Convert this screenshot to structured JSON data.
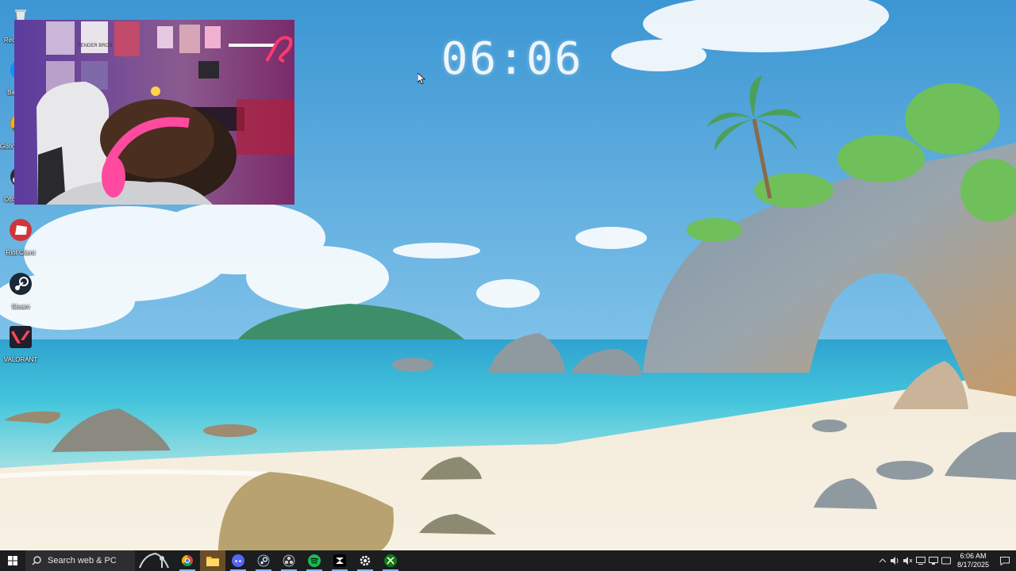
{
  "clock": {
    "time": "06:06"
  },
  "desktop_icons": [
    {
      "label": "Recycle Bin",
      "icon": "recycle-bin-icon"
    },
    {
      "label": "Battle.net",
      "icon": "battlenet-icon"
    },
    {
      "label": "Google Chrome",
      "icon": "chrome-icon"
    },
    {
      "label": "OBS Studio",
      "icon": "obs-icon"
    },
    {
      "label": "Riot Client",
      "icon": "riot-client-icon"
    },
    {
      "label": "Steam",
      "icon": "steam-icon"
    },
    {
      "label": "VALORANT",
      "icon": "valorant-icon"
    }
  ],
  "webcam": {
    "headset_brand": "TENDER BROS"
  },
  "taskbar": {
    "search_placeholder": "Search web & PC",
    "apps": [
      {
        "name": "chrome-icon"
      },
      {
        "name": "file-explorer-icon",
        "active": true
      },
      {
        "name": "discord-icon"
      },
      {
        "name": "steam-icon"
      },
      {
        "name": "obs-icon"
      },
      {
        "name": "spotify-icon"
      },
      {
        "name": "capcut-icon"
      },
      {
        "name": "settings-icon"
      },
      {
        "name": "xbox-icon"
      }
    ],
    "tray": {
      "time": "6:06 AM",
      "date": "8/17/2025"
    }
  },
  "colors": {
    "taskbar": "#1c1d1f",
    "accent": "#8ab4f8",
    "sky": "#4aa3db",
    "sea": "#3fc3d8"
  }
}
